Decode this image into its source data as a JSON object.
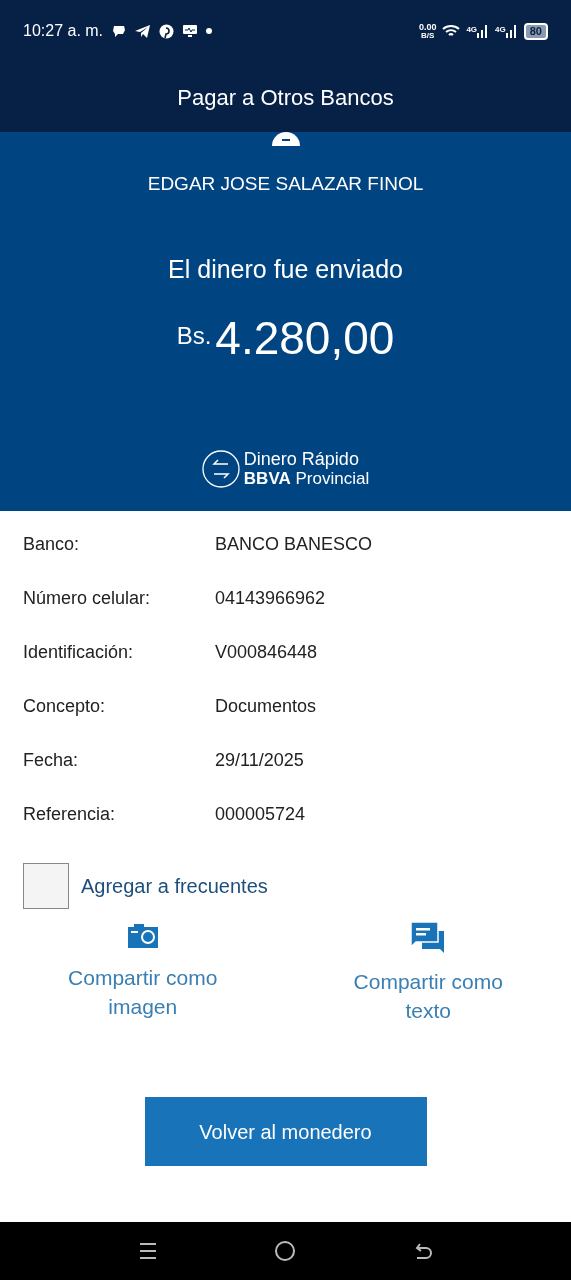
{
  "status_bar": {
    "time": "10:27 a. m.",
    "net_speed": "0.00",
    "net_unit": "B/S",
    "networks": [
      "4G",
      "4G"
    ],
    "battery": "80"
  },
  "header": {
    "title": "Pagar a Otros Bancos"
  },
  "summary": {
    "recipient": "EDGAR JOSE SALAZAR FINOL",
    "message": "El dinero fue enviado",
    "currency": "Bs.",
    "amount": "4.280,00",
    "logo_line_1": "Dinero Rápido",
    "logo_line_2": "**BBVA** Provincial"
  },
  "details": [
    {
      "label": "Banco:",
      "value": "BANCO BANESCO"
    },
    {
      "label": "Número celular:",
      "value": "04143966962"
    },
    {
      "label": "Identificación:",
      "value": "V000846448"
    },
    {
      "label": "Concepto:",
      "value": "Documentos"
    },
    {
      "label": "Fecha:",
      "value": "29/11/2025"
    },
    {
      "label": "Referencia:",
      "value": "000005724"
    }
  ],
  "favorite": {
    "label": "Agregar a frecuentes",
    "checked": false
  },
  "share_actions": [
    {
      "kind": "image",
      "label": "Compartir como imagen"
    },
    {
      "kind": "text",
      "label": "Compartir como texto"
    }
  ],
  "primary_button": "Volver al monedero"
}
